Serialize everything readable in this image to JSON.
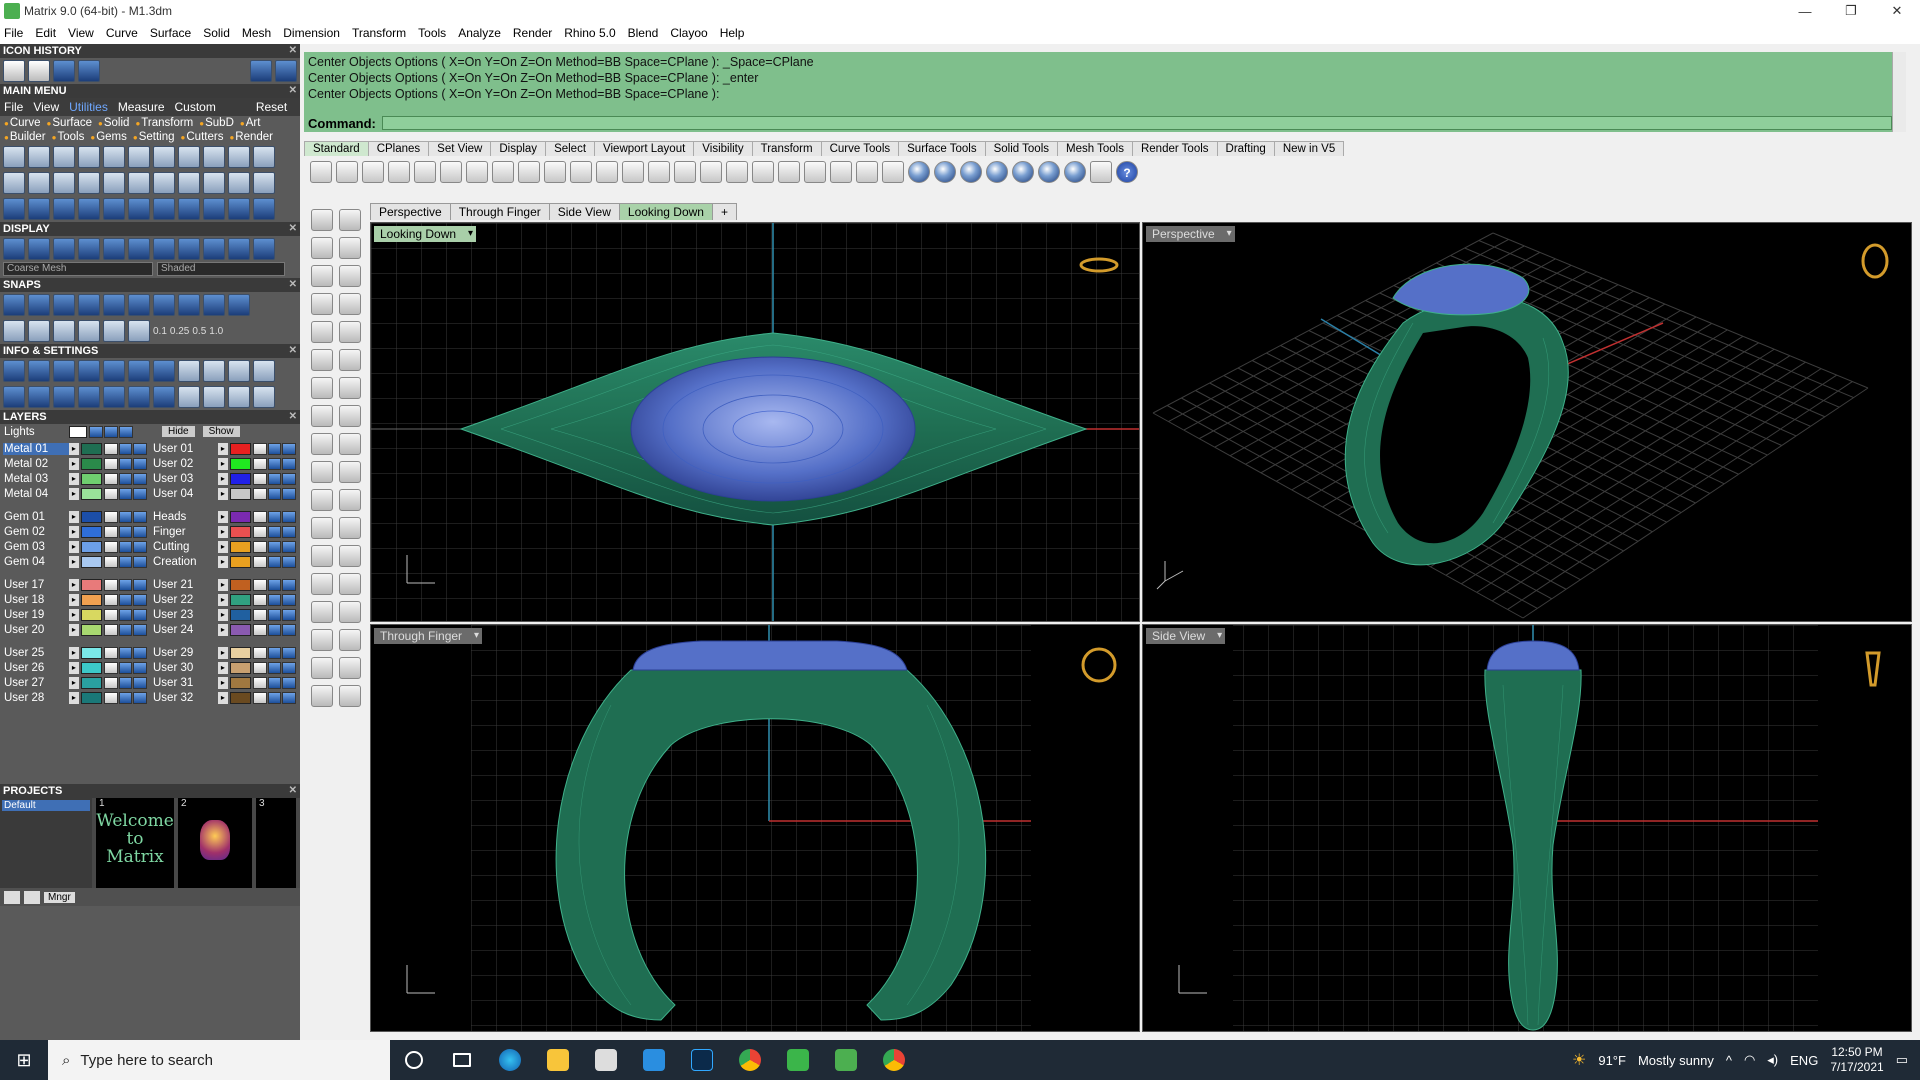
{
  "window": {
    "title": "Matrix 9.0 (64-bit) - M1.3dm"
  },
  "menu": [
    "File",
    "Edit",
    "View",
    "Curve",
    "Surface",
    "Solid",
    "Mesh",
    "Dimension",
    "Transform",
    "Tools",
    "Analyze",
    "Render",
    "Rhino 5.0",
    "Blend",
    "Clayoo",
    "Help"
  ],
  "left": {
    "icon_history": "ICON HISTORY",
    "main_menu": "MAIN MENU",
    "mm_row1": [
      "File",
      "View",
      "Utilities",
      "Measure",
      "Custom",
      "Reset"
    ],
    "mm_row2": [
      "Curve",
      "Surface",
      "Solid",
      "Transform",
      "SubD",
      "Art"
    ],
    "mm_row3": [
      "Builder",
      "Tools",
      "Gems",
      "Setting",
      "Cutters",
      "Render"
    ],
    "display": "DISPLAY",
    "display_mesh": "Coarse Mesh",
    "display_mode": "Shaded",
    "snaps": "SNAPS",
    "snap_values": [
      "0.1",
      "0.25",
      "0.5",
      "1.0"
    ],
    "info": "INFO & SETTINGS",
    "layers": "LAYERS",
    "lights": "Lights",
    "hide": "Hide",
    "show": "Show",
    "layers_left": [
      "Metal 01",
      "Metal 02",
      "Metal 03",
      "Metal 04",
      "",
      "Gem 01",
      "Gem 02",
      "Gem 03",
      "Gem 04",
      "",
      "User 17",
      "User 18",
      "User 19",
      "User 20",
      "",
      "User 25",
      "User 26",
      "User 27",
      "User 28"
    ],
    "layers_right": [
      "User 01",
      "User 02",
      "User 03",
      "User 04",
      "",
      "Heads",
      "Finger",
      "Cutting",
      "Creation",
      "",
      "User 21",
      "User 22",
      "User 23",
      "User 24",
      "",
      "User 29",
      "User 30",
      "User 31",
      "User 32"
    ],
    "projects": "PROJECTS",
    "proj_default": "Default",
    "thumb_text": "Welcome to Matrix",
    "thumb_nums": [
      "1",
      "2",
      "3"
    ],
    "mngr": "Mngr"
  },
  "command": {
    "history": [
      "Center Objects Options ( X=On  Y=On  Z=On  Method=BB  Space=CPlane ): _Space=CPlane",
      "Center Objects Options ( X=On  Y=On  Z=On  Method=BB  Space=CPlane ): _enter",
      "Center Objects Options ( X=On  Y=On  Z=On  Method=BB  Space=CPlane ):"
    ],
    "label": "Command:"
  },
  "tool_tabs": [
    "Standard",
    "CPlanes",
    "Set View",
    "Display",
    "Select",
    "Viewport Layout",
    "Visibility",
    "Transform",
    "Curve Tools",
    "Surface Tools",
    "Solid Tools",
    "Mesh Tools",
    "Render Tools",
    "Drafting",
    "New in V5"
  ],
  "viewport_tabs": [
    "Perspective",
    "Through Finger",
    "Side View",
    "Looking Down"
  ],
  "viewports": {
    "top_left": "Looking Down",
    "top_right": "Perspective",
    "bottom_left": "Through Finger",
    "bottom_right": "Side View"
  },
  "taskbar": {
    "search": "Type here to search",
    "weather_temp": "91°F",
    "weather_text": "Mostly sunny",
    "lang": "ENG",
    "time": "12:50 PM",
    "date": "7/17/2021"
  }
}
